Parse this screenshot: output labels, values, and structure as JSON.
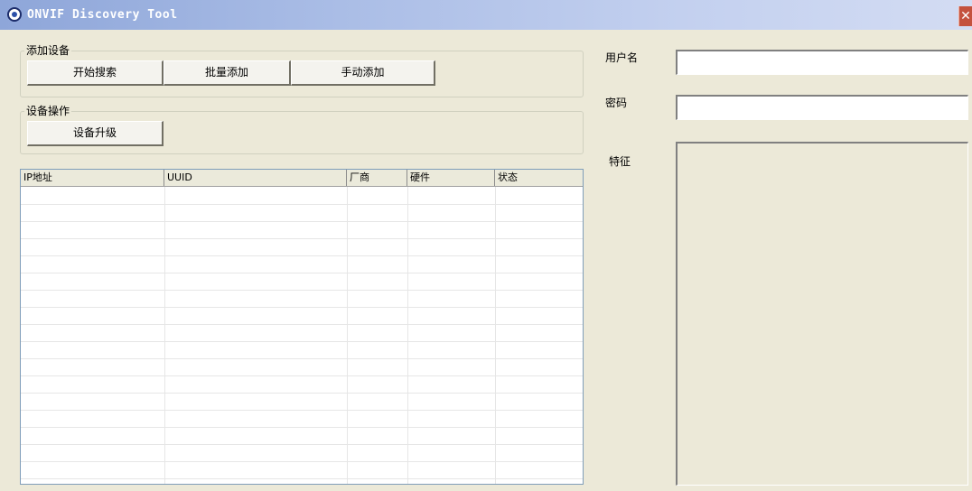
{
  "window": {
    "title": "ONVIF Discovery Tool",
    "close_glyph": "✕"
  },
  "add_group": {
    "title": "添加设备",
    "buttons": [
      "开始搜索",
      "批量添加",
      "手动添加"
    ]
  },
  "ops_group": {
    "title": "设备操作",
    "buttons": [
      "设备升级"
    ]
  },
  "table": {
    "columns": [
      "IP地址",
      "UUID",
      "厂商",
      "硬件",
      "状态"
    ],
    "rows": []
  },
  "form": {
    "username_label": "用户名",
    "username_value": "",
    "password_label": "密码",
    "password_value": "",
    "feature_label": "特征",
    "feature_value": ""
  },
  "colors": {
    "window_bg": "#ece9d8",
    "close_button": "#c4523e"
  }
}
